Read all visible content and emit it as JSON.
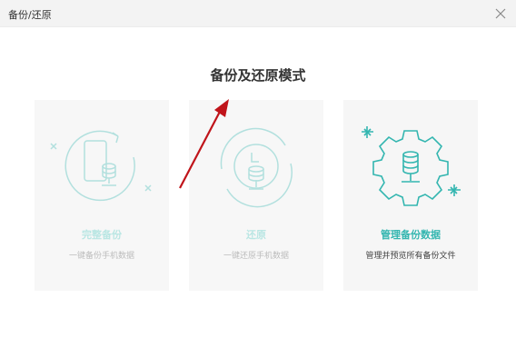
{
  "window": {
    "title": "备份/还原"
  },
  "heading": "备份及还原模式",
  "cards": [
    {
      "label": "完整备份",
      "desc": "一键备份手机数据",
      "state": "disabled"
    },
    {
      "label": "还原",
      "desc": "一键还原手机数据",
      "state": "disabled"
    },
    {
      "label": "管理备份数据",
      "desc": "管理并预览所有备份文件",
      "state": "enabled"
    }
  ],
  "colors": {
    "accent": "#34b6b0",
    "annotation_arrow": "#c0141a"
  },
  "icons": [
    "close-icon",
    "phone-backup-icon",
    "restore-icon",
    "gear-database-icon",
    "red-arrow-annotation"
  ]
}
